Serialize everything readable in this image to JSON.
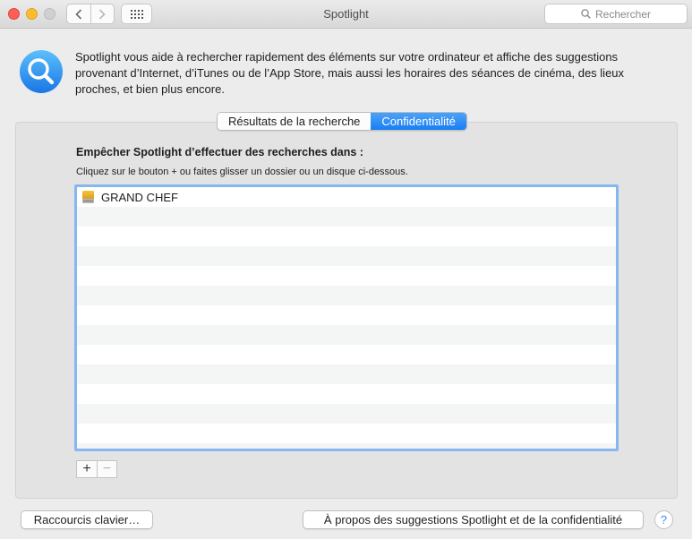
{
  "window": {
    "title": "Spotlight"
  },
  "toolbar": {
    "back_icon": "chevron-left-icon",
    "forward_icon": "chevron-right-icon",
    "grid_icon": "grid-icon",
    "search_placeholder": "Rechercher"
  },
  "header": {
    "icon": "spotlight-magnifier-icon",
    "description": "Spotlight vous aide à rechercher rapidement des éléments sur votre ordinateur et affiche des suggestions provenant d’Internet, d’iTunes ou de l’App Store, mais aussi les horaires des séances de cinéma, des lieux proches, et bien plus encore."
  },
  "tabs": [
    {
      "label": "Résultats de la recherche",
      "active": false
    },
    {
      "label": "Confidentialité",
      "active": true
    }
  ],
  "privacy": {
    "title": "Empêcher Spotlight d’effectuer des recherches dans :",
    "hint": "Cliquez sur le bouton + ou faites glisser un dossier ou un disque ci-dessous.",
    "items": [
      {
        "label": "GRAND CHEF",
        "icon": "hard-drive-icon"
      }
    ],
    "add_label": "+",
    "remove_label": "−"
  },
  "footer": {
    "shortcuts_label": "Raccourcis clavier…",
    "about_label": "À propos des suggestions Spotlight et de la confidentialité",
    "help_label": "?"
  },
  "colors": {
    "accent": "#1a7ef3",
    "focus_ring": "#86b7f2",
    "close": "#fd5f57",
    "minimize": "#fdbc2e"
  }
}
